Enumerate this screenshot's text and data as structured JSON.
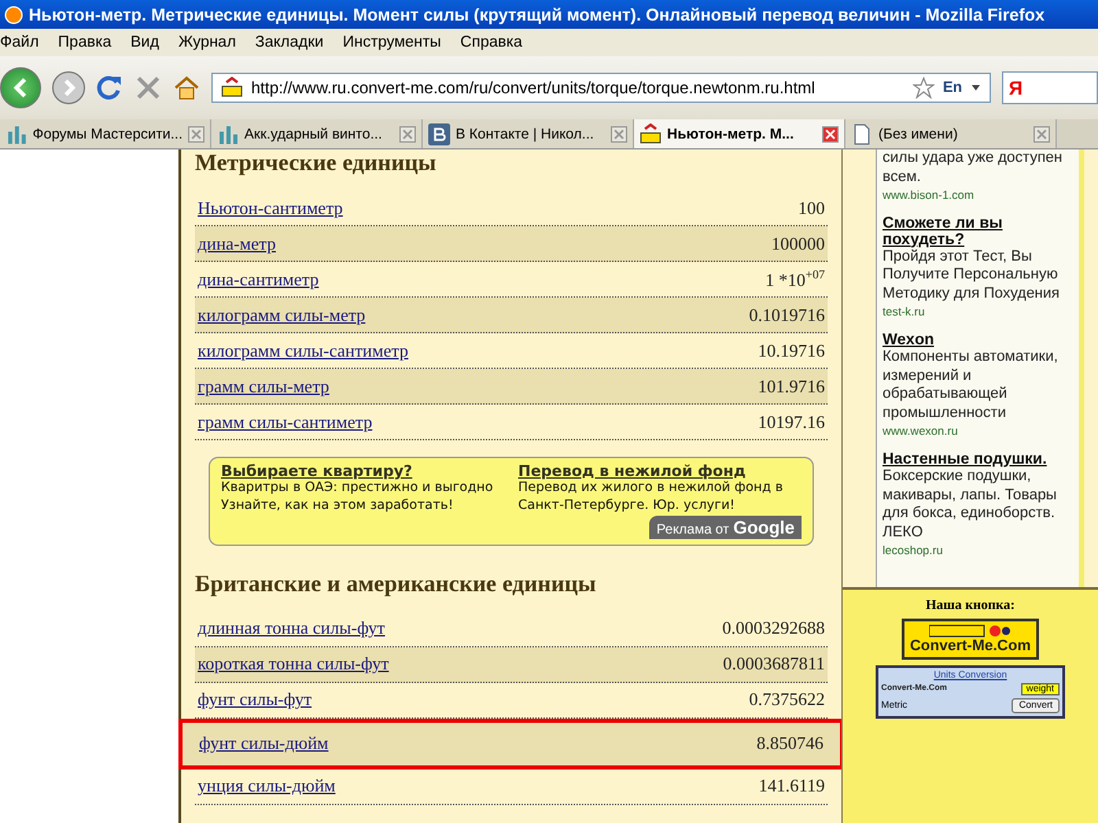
{
  "window": {
    "title": "Ньютон-метр. Метрические единицы. Момент силы (крутящий момент). Онлайновый перевод величин - Mozilla Firefox"
  },
  "menu": [
    "Файл",
    "Правка",
    "Вид",
    "Журнал",
    "Закладки",
    "Инструменты",
    "Справка"
  ],
  "address_bar": {
    "url": "http://www.ru.convert-me.com/ru/convert/units/torque/torque.newtonm.ru.html",
    "language": "En",
    "search_engine": "Я"
  },
  "tabs": [
    {
      "label": "Форумы Мастерсити...",
      "selected": false,
      "kind": "forum"
    },
    {
      "label": "Акк.ударный винто...",
      "selected": false,
      "kind": "forum"
    },
    {
      "label": "В Контакте | Никол...",
      "selected": false,
      "kind": "vk"
    },
    {
      "label": "Ньютон-метр. М...",
      "selected": true,
      "kind": "site"
    },
    {
      "label": "(Без имени)",
      "selected": false,
      "kind": "blank"
    }
  ],
  "sections": [
    {
      "heading": "Метрические единицы",
      "rows": [
        {
          "unit": "Ньютон-сантиметр",
          "value": "100",
          "highlighted": false
        },
        {
          "unit": "дина-метр",
          "value": "100000",
          "highlighted": false
        },
        {
          "unit": "дина-сантиметр",
          "value": "1 *10$^{+07}$",
          "highlighted": false
        },
        {
          "unit": "килограмм силы-метр",
          "value": "0.1019716",
          "highlighted": false
        },
        {
          "unit": "килограмм силы-сантиметр",
          "value": "10.19716",
          "highlighted": false
        },
        {
          "unit": "грамм силы-метр",
          "value": "101.9716",
          "highlighted": false
        },
        {
          "unit": "грамм силы-сантиметр",
          "value": "10197.16",
          "highlighted": false
        }
      ]
    },
    {
      "heading": "Британские и американские единицы",
      "rows": [
        {
          "unit": "длинная тонна силы-фут",
          "value": "0.0003292688",
          "highlighted": false
        },
        {
          "unit": "короткая тонна силы-фут",
          "value": "0.0003687811",
          "highlighted": false
        },
        {
          "unit": "фунт силы-фут",
          "value": "0.7375622",
          "highlighted": false
        },
        {
          "unit": "фунт силы-дюйм",
          "value": "8.850746",
          "highlighted": true
        },
        {
          "unit": "унция силы-дюйм",
          "value": "141.6119",
          "highlighted": false
        }
      ]
    }
  ],
  "ad_banner": {
    "ads": [
      {
        "title": "Выбираете квартиру?",
        "text": "Кваритры в ОАЭ: престижно и выгодно Узнайте, как на этом заработать!"
      },
      {
        "title": "Перевод в нежилой фонд",
        "text": "Перевод их жилого в нежилой фонд в Санкт-Петербурге. Юр. услуги!"
      }
    ],
    "badge": "Реклама от",
    "brand": "Google"
  },
  "sidebar": {
    "ads": [
      {
        "text": "силы удара уже доступен всем.",
        "url": "www.bison-1.com"
      },
      {
        "title": "Сможете ли вы похудеть?",
        "text": "Пройдя этот Тест, Вы Получите Персональную Методику для Похудения",
        "url": "test-k.ru"
      },
      {
        "title": "Wexon",
        "text": "Компоненты автоматики, измерений и обрабатывающей промышленности",
        "url": "www.wexon.ru"
      },
      {
        "title": "Настенные подушки.",
        "text": "Боксерские подушки, макивары, лапы. Товары для бокса, единоборств. ЛЕКО",
        "url": "lecoshop.ru"
      }
    ],
    "button_heading": "Наша кнопка:",
    "logo_text": "Convert-Me.Com",
    "widget": {
      "title": "Units Conversion",
      "logo_text": "Convert-Me.Com",
      "select": "weight",
      "label": "Metric",
      "button": "Convert"
    }
  }
}
